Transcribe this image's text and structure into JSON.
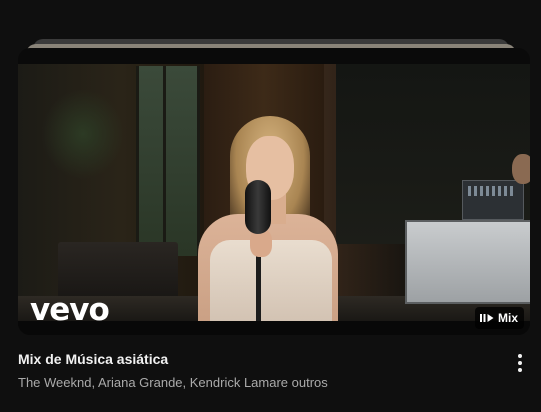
{
  "card": {
    "title": "Mix de Música asiática",
    "subtitle": "The Weeknd, Ariana Grande, Kendrick Lamare outros",
    "badge_label": "Mix",
    "badge_icon": "mix-playlist-icon",
    "logo_text": "vevo",
    "more_icon": "more-vert-icon"
  },
  "colors": {
    "background": "#0f0f0f",
    "title": "#f1f1f1",
    "subtitle": "#aaaaaa",
    "badge_bg": "#000000"
  }
}
